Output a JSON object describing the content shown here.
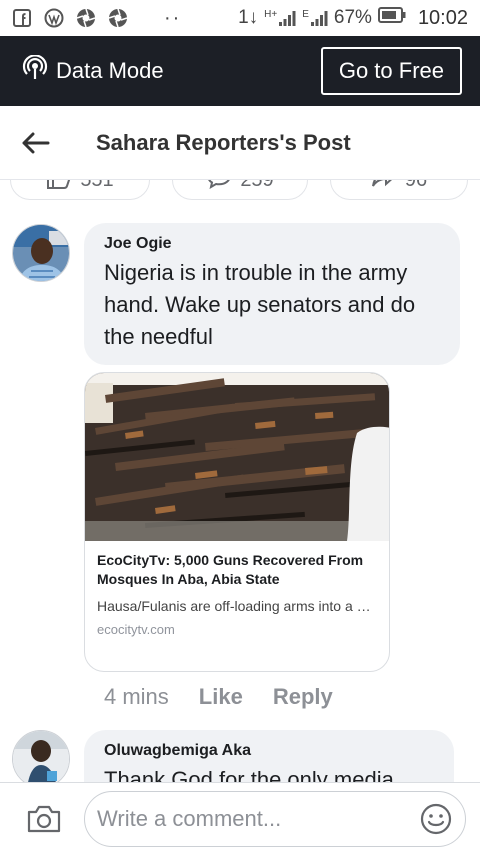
{
  "status_bar": {
    "app_icons": [
      "facebook-icon",
      "wordpress-icon",
      "aperture-icon",
      "aperture-icon"
    ],
    "dots": "··",
    "network": "1↓",
    "signal1_label": "H+",
    "signal2_label": "E",
    "battery": "67%",
    "time": "10:02"
  },
  "data_bar": {
    "mode_label": "Data Mode",
    "go_free_label": "Go to Free"
  },
  "header": {
    "title": "Sahara Reporters's Post"
  },
  "reaction_pills": [
    {
      "icon": "thumbs-up-icon",
      "count": "551"
    },
    {
      "icon": "comment-icon",
      "count": "259"
    },
    {
      "icon": "share-icon",
      "count": "96"
    }
  ],
  "comments": [
    {
      "author": "Joe Ogie",
      "text": "Nigeria is in trouble in the army hand. Wake up senators and do the needful",
      "link": {
        "title": "EcoCityTv: 5,000 Guns Recovered From Mosques In Aba, Abia State",
        "description": "Hausa/Fulanis are off-loading arms into a Mosque located at Onions market, Uratta...",
        "domain": "ecocitytv.com"
      },
      "time": "4 mins",
      "like_label": "Like",
      "reply_label": "Reply"
    },
    {
      "author": "Oluwagbemiga Aka",
      "text": "Thank God for the only media"
    }
  ],
  "composer": {
    "placeholder": "Write a comment..."
  },
  "colors": {
    "data_bar_bg": "#1c1f26",
    "bubble_bg": "#f0f2f5",
    "muted_text": "#8d9096"
  }
}
